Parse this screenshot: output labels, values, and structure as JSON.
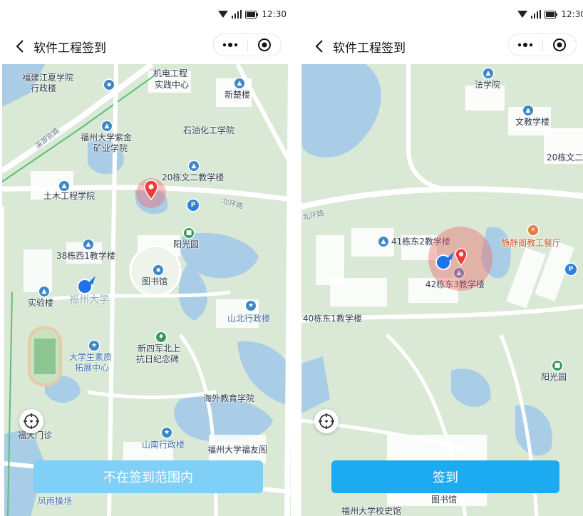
{
  "colors": {
    "map_land": "#d9e9d6",
    "water": "#a9cde6",
    "road": "#ffffff",
    "building": "#ffffff",
    "primary_button": "#1cabf0",
    "disabled_button": "#7fcff6",
    "pin_red": "#ee3b3b",
    "user_blue": "#1e73e8",
    "range_fill": "rgba(235,105,105,0.42)"
  },
  "status_bar": {
    "time": "12:30"
  },
  "left_phone": {
    "nav": {
      "title": "软件工程签到",
      "more_icon": "more-dots-icon",
      "close_icon": "target-close-icon"
    },
    "map_labels": {
      "fj_jiangxia_1": "福建江夏学院",
      "fj_jiangxia_2": "行政楼",
      "jidian_1": "机电工程",
      "jidian_2": "实践中心",
      "xinchu": "新楚楼",
      "road_diagonal": "溪源宫路",
      "zijin_1": "福州大学紫金",
      "zijin_2": "矿业学院",
      "shihua": "石油化工学院",
      "wen20": "20栋文二教学楼",
      "tumu": "土木工程学院",
      "beihuan": "北环路",
      "yangguang": "阳光园",
      "xi38": "38栋西1教学楼",
      "tushuguan": "图书馆",
      "shiyan": "实验楼",
      "fuzhou_daxue": "福州大学",
      "shanbei": "山北行政楼",
      "xsfz_1": "大学生素质",
      "xsfz_2": "拓展中心",
      "xinsijun_1": "新四军北上",
      "xinsijun_2": "抗日纪念碑",
      "haiwai": "海外教育学院",
      "menzhen": "福大门诊",
      "shannan": "山南行政楼",
      "xiaoyou": "福州大学福友阁",
      "fengyu": "凤雨操场"
    },
    "button_label": "不在签到范围内",
    "locate_icon": "locate-crosshair-icon"
  },
  "right_phone": {
    "nav": {
      "title": "软件工程签到",
      "more_icon": "more-dots-icon",
      "close_icon": "target-close-icon"
    },
    "map_labels": {
      "faxueyuan": "法学院",
      "wenjiaoxue": "文教学楼",
      "wen20": "20栋文二",
      "beihuan": "北环路",
      "dong41": "41栋东2教学楼",
      "jingjingge": "静静阁教工餐厅",
      "dong42": "42栋东3教学楼",
      "dong40": "40栋东1教学楼",
      "yangguang": "阳光园",
      "tushuguan": "图书馆",
      "xiaoshiguan": "福州大学校史馆"
    },
    "button_label": "签到",
    "locate_icon": "locate-crosshair-icon"
  }
}
